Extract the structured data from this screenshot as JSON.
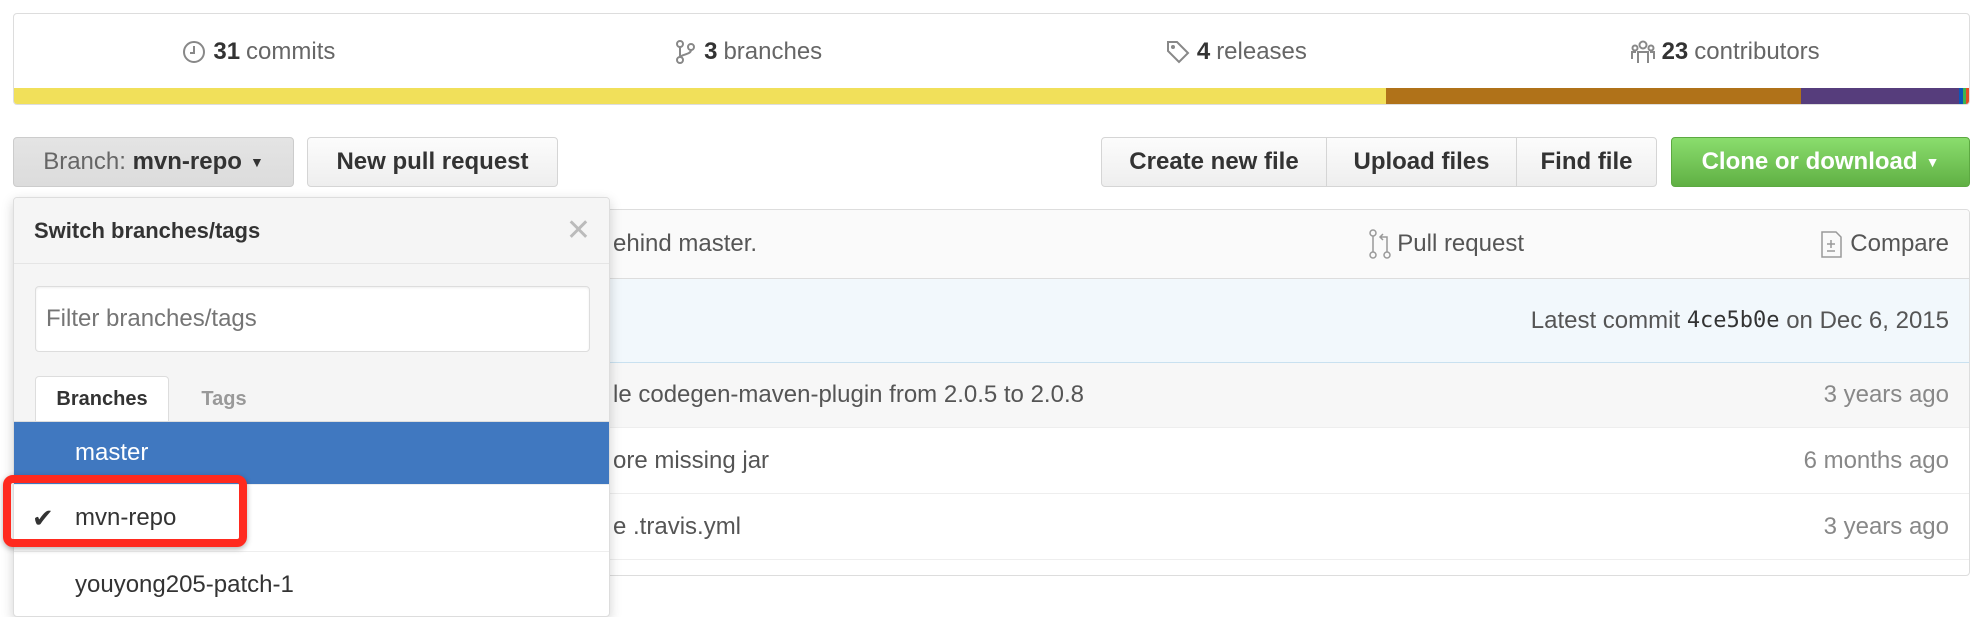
{
  "stats": [
    {
      "icon": "history-icon",
      "count": "31",
      "label": "commits"
    },
    {
      "icon": "branch-icon",
      "count": "3",
      "label": "branches"
    },
    {
      "icon": "tag-icon",
      "count": "4",
      "label": "releases"
    },
    {
      "icon": "people-icon",
      "count": "23",
      "label": "contributors"
    }
  ],
  "languages": [
    {
      "color": "#f1e05a",
      "percent": 70.2
    },
    {
      "color": "#b07219",
      "percent": 21.2
    },
    {
      "color": "#563d7c",
      "percent": 8.1
    },
    {
      "color": "#0c57b8",
      "percent": 0.2
    },
    {
      "color": "#3fb34f",
      "percent": 0.15
    },
    {
      "color": "#e34c26",
      "percent": 0.15
    }
  ],
  "toolbar": {
    "branch_prefix": "Branch:",
    "branch_name": "mvn-repo",
    "new_pr": "New pull request",
    "create_file": "Create new file",
    "upload": "Upload files",
    "find": "Find file",
    "clone": "Clone or download"
  },
  "filebox": {
    "behind_text": "ehind master.",
    "pull_request": "Pull request",
    "compare": "Compare",
    "latest_prefix": "Latest commit",
    "latest_sha": "4ce5b0e",
    "latest_date": "on Dec 6, 2015",
    "rows": [
      {
        "message": "le codegen-maven-plugin from 2.0.5 to 2.0.8",
        "age": "3 years ago"
      },
      {
        "message": "ore missing jar",
        "age": "6 months ago"
      },
      {
        "message": "e .travis.yml",
        "age": "3 years ago"
      }
    ]
  },
  "dropdown": {
    "title": "Switch branches/tags",
    "filter_placeholder": "Filter branches/tags",
    "tabs": [
      "Branches",
      "Tags"
    ],
    "branches": [
      "master",
      "mvn-repo",
      "youyong205-patch-1"
    ],
    "selected": "mvn-repo",
    "highlighted": "master"
  },
  "colors": {
    "accent": "#4078c0",
    "clone_green": "#6cc644",
    "highlight_box": "#ff2a1f"
  }
}
